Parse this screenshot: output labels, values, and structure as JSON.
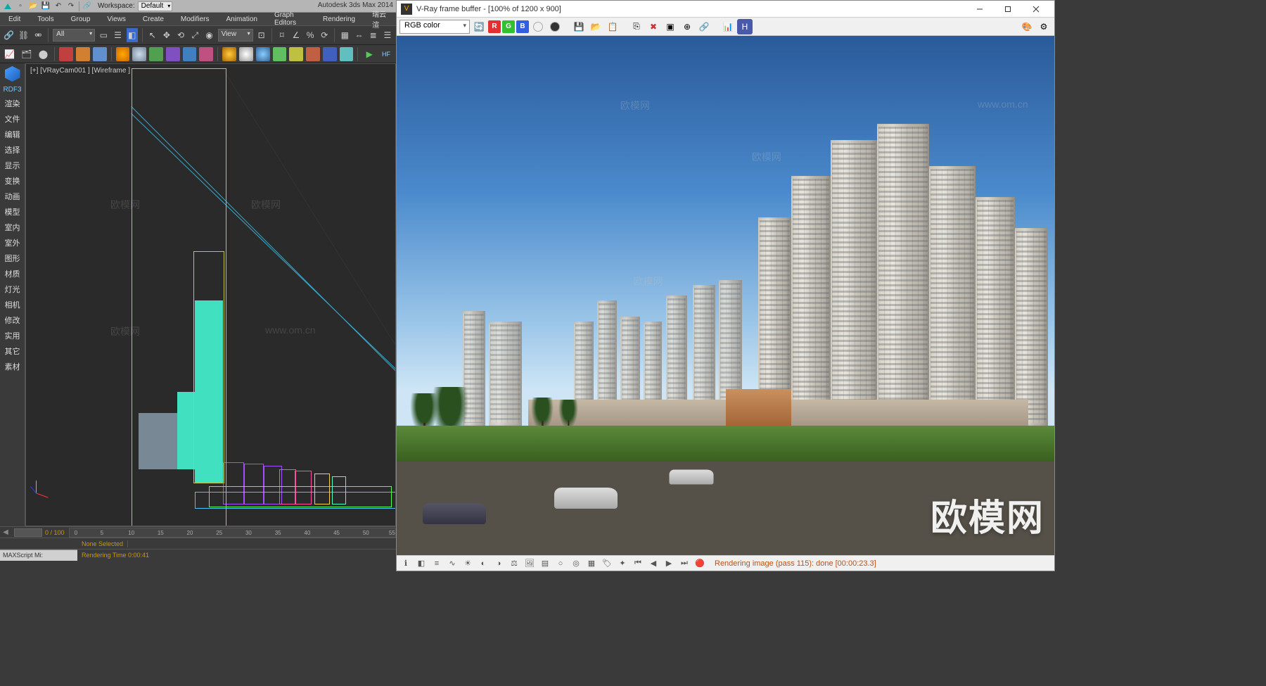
{
  "max": {
    "qat": {
      "workspace_label": "Workspace:",
      "workspace_value": "Default"
    },
    "title": "Autodesk 3ds Max  2014",
    "menu": [
      "Edit",
      "Tools",
      "Group",
      "Views",
      "Create",
      "Modifiers",
      "Animation",
      "Graph Editors",
      "Rendering",
      "瑞云渲"
    ],
    "toolbar_all": "All",
    "toolbar_view": "View",
    "side": {
      "label": "RDF3",
      "items": [
        "渲染",
        "文件",
        "编辑",
        "选择",
        "显示",
        "变换",
        "动画",
        "模型",
        "室内",
        "室外",
        "图形",
        "材质",
        "灯光",
        "相机",
        "修改",
        "实用",
        "其它",
        "素材"
      ]
    },
    "viewport_label": "[+] [VRayCam001 ] [Wireframe ]",
    "timeline": {
      "pos": "0 / 100",
      "ticks": [
        0,
        5,
        10,
        15,
        20,
        25,
        30,
        35,
        40,
        45,
        50,
        55
      ]
    },
    "status": {
      "none_selected": "None Selected",
      "render_time": "Rendering Time  0:00:41",
      "maxscript": "MAXScript Mi:"
    }
  },
  "vfb": {
    "title": "V-Ray frame buffer - [100% of 1200 x 900]",
    "channel_dropdown": "RGB color",
    "channels": [
      "R",
      "G",
      "B"
    ],
    "status_text": "Rendering image (pass 115): done [00:00:23.3]"
  },
  "watermarks": {
    "big": "欧模网",
    "small": "欧模网",
    "url": "www.om.cn"
  }
}
